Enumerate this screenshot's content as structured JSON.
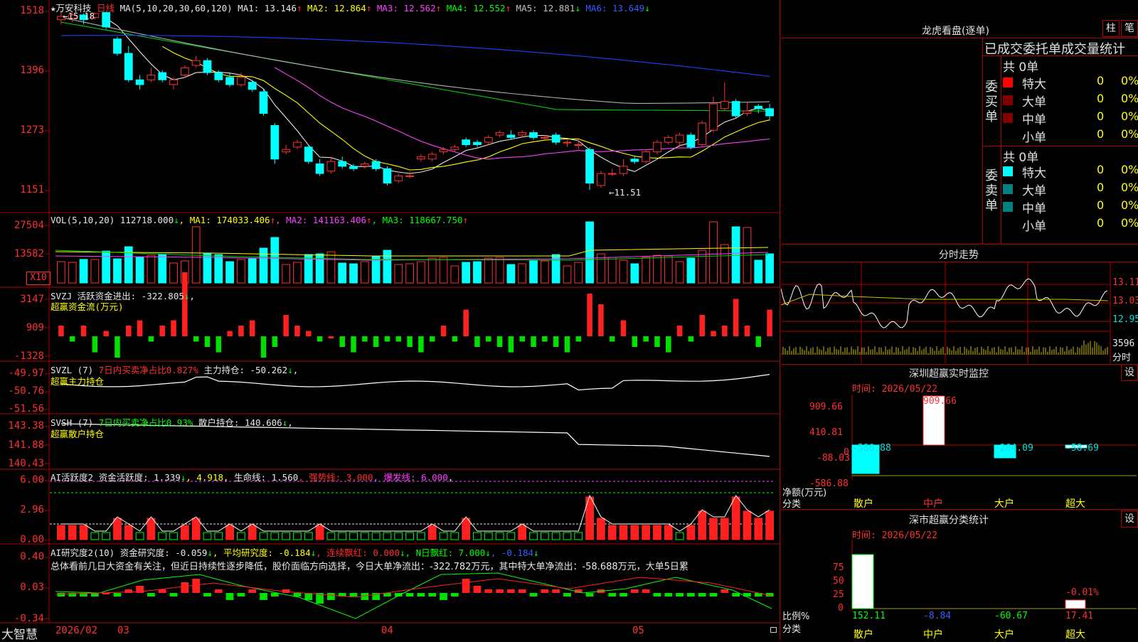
{
  "stock": {
    "name": "★万安科技",
    "period": "日线"
  },
  "price_panel": {
    "ma_info": [
      {
        "t": "MA(5,10,20,30,60,120)",
        "c": "c-w",
        "a": ""
      },
      {
        "t": " MA1: 13.146",
        "c": "c-w",
        "a": "↑"
      },
      {
        "t": " MA2: 12.864",
        "c": "c-y",
        "a": "↑"
      },
      {
        "t": " MA3: 12.562",
        "c": "c-m",
        "a": "↑"
      },
      {
        "t": " MA4: 12.552",
        "c": "c-g",
        "a": "↑"
      },
      {
        "t": " MA5: 12.881",
        "c": "c-gray",
        "a": "↓"
      },
      {
        "t": " MA6: 13.649",
        "c": "c-b",
        "a": "↓"
      }
    ],
    "axis": [
      "1518",
      "1396",
      "1273",
      "1151"
    ],
    "high_mark": "←15.18",
    "low_mark": "←11.51"
  },
  "vol_panel": {
    "info": [
      {
        "t": "VOL(5,10,20) ",
        "c": "c-w",
        "a": ""
      },
      {
        "t": "112718.000",
        "c": "c-w",
        "a": "↓"
      },
      {
        "t": ", MA1: 174033.406",
        "c": "c-y",
        "a": "↑"
      },
      {
        "t": ", MA2: 141163.406",
        "c": "c-m",
        "a": "↑"
      },
      {
        "t": ", MA3: 118667.750",
        "c": "c-g",
        "a": "↑"
      }
    ],
    "axis": [
      "27504",
      "13582"
    ],
    "unit": "X10"
  },
  "svzj_panel": {
    "line1": [
      {
        "t": "SVZJ  活跃资金进出: -322.805",
        "c": "c-w",
        "a": "↓"
      },
      {
        "t": ",",
        "c": "c-w",
        "a": ""
      }
    ],
    "line2": "超赢资金流(万元)",
    "axis": [
      "3147",
      "909",
      "-1328"
    ]
  },
  "svzl_panel": {
    "line1": [
      {
        "t": "SVZL (7) ",
        "c": "c-w",
        "a": ""
      },
      {
        "t": "7日内买卖净占比0.827%",
        "c": "c-r",
        "a": ""
      },
      {
        "t": " 主力持仓: -50.262",
        "c": "c-w",
        "a": "↓"
      },
      {
        "t": ",",
        "c": "c-w",
        "a": ""
      }
    ],
    "line2": "超赢主力持仓",
    "axis": [
      "-49.97",
      "-50.76",
      "-51.56"
    ]
  },
  "svsh_panel": {
    "line1": [
      {
        "t": "SVSH (7) ",
        "c": "c-w",
        "a": ""
      },
      {
        "t": "7日内买卖净占比0.93%",
        "c": "c-g",
        "a": ""
      },
      {
        "t": " 散户持仓: 140.606",
        "c": "c-w",
        "a": "↓"
      },
      {
        "t": ",",
        "c": "c-w",
        "a": ""
      }
    ],
    "line2": "超赢散户持仓",
    "axis": [
      "143.38",
      "141.88",
      "140.43"
    ]
  },
  "ai1_panel": {
    "line1": [
      {
        "t": "AI活跃度2 资金活跃度: 1.339",
        "c": "c-w",
        "a": "↓"
      },
      {
        "t": ", 4.918",
        "c": "c-y",
        "a": ""
      },
      {
        "t": ", 生命线: 1.560",
        "c": "c-w",
        "a": ""
      },
      {
        "t": ", 强势线: 3.000",
        "c": "c-r",
        "a": ""
      },
      {
        "t": ", 爆发线: 6.000",
        "c": "c-m",
        "a": ""
      },
      {
        "t": ",",
        "c": "c-w",
        "a": ""
      }
    ],
    "axis": [
      "6.00",
      "2.96",
      "0.00"
    ]
  },
  "ai2_panel": {
    "line1": [
      {
        "t": "AI研究度2(10) 资金研究度: -0.059",
        "c": "c-w",
        "a": "↓"
      },
      {
        "t": ", 平均研究度: -0.184",
        "c": "c-y",
        "a": "↓"
      },
      {
        "t": ", 连续飘红: 0.000",
        "c": "c-r",
        "a": "↓"
      },
      {
        "t": ", N日飘红: 7.000",
        "c": "c-g",
        "a": "↓"
      },
      {
        "t": ", -0.184",
        "c": "c-b",
        "a": "↓"
      }
    ],
    "summary": "总体看前几日大资金有关注，但近日持续性逐步降低，股价面临方向选择，今日大单净流出：-322.782万元，其中特大单净流出：-58.688万元，大单5日累",
    "axis": [
      "0.40",
      "0.03",
      "-0.34"
    ]
  },
  "dates": {
    "d1": "2026/02",
    "d2": "03",
    "d3": "04",
    "d4": "05"
  },
  "brand": "大智慧",
  "right": {
    "dragon_title": "龙虎看盘(逐单)",
    "btn_bar": "柱",
    "btn_pen": "笔",
    "dragon_header": "已成交委托单成交量统计",
    "buy_label": "委买单",
    "sell_label": "委卖单",
    "buy_total": "共 0单",
    "sell_total": "共 0单",
    "buy_rows": [
      {
        "label": "特大",
        "v": "0",
        "p": "0%",
        "color": "#ff0000"
      },
      {
        "label": "大单",
        "v": "0",
        "p": "0%",
        "color": "#800000"
      },
      {
        "label": "中单",
        "v": "0",
        "p": "0%",
        "color": "#800000"
      },
      {
        "label": "小单",
        "v": "0",
        "p": "0%",
        "color": ""
      }
    ],
    "sell_rows": [
      {
        "label": "特大",
        "v": "0",
        "p": "0%",
        "color": "#00ffff"
      },
      {
        "label": "大单",
        "v": "0",
        "p": "0%",
        "color": "#008080"
      },
      {
        "label": "中单",
        "v": "0",
        "p": "0%",
        "color": "#008080"
      },
      {
        "label": "小单",
        "v": "0",
        "p": "0%",
        "color": ""
      }
    ],
    "intraday_title": "分时走势",
    "intraday_axis": [
      "13.11",
      "13.03",
      "12.95"
    ],
    "intraday_vol": "3596",
    "intraday_unit": "分时",
    "monitor_title": "深圳超赢实时监控",
    "monitor_btn": "设",
    "monitor_time": "时间: 2026/05/22",
    "monitor_axis": [
      "909.66",
      "410.81",
      "-88.03",
      "-586.88"
    ],
    "monitor_axis_zero": "0",
    "monitor_unit1": "净额(万元)",
    "monitor_unit2": "分类",
    "monitor_cats": [
      "散户",
      "中户",
      "大户",
      "超大"
    ],
    "monitor_values": [
      "-586.88",
      "909.66",
      "-264.09",
      "-58.69"
    ],
    "class_title": "深市超赢分类统计",
    "class_btn": "设",
    "class_time": "时间: 2026/05/22",
    "class_axis": [
      "75",
      "50",
      "25",
      "0"
    ],
    "class_unit1": "比例%",
    "class_unit2": "分类",
    "class_cats": [
      "散户",
      "中户",
      "大户",
      "超大"
    ],
    "class_values": [
      "152.11",
      "-8.84",
      "-60.67",
      "17.41"
    ],
    "class_extra": "-0.01%"
  },
  "chart_data": [
    {
      "type": "candlestick",
      "y_axis_ticks": [
        "1518",
        "1396",
        "1273",
        "1151"
      ],
      "candles": [
        [
          15.05,
          15.12,
          14.95,
          15.25
        ],
        [
          15.08,
          15.15,
          15.0,
          15.2
        ],
        [
          15.15,
          15.05,
          14.95,
          15.18
        ],
        [
          15.1,
          15.18,
          15.05,
          15.2
        ],
        [
          15.2,
          14.9,
          14.85,
          15.22
        ],
        [
          14.65,
          14.35,
          14.3,
          14.7
        ],
        [
          14.35,
          13.8,
          13.75,
          14.5
        ],
        [
          13.8,
          13.7,
          13.6,
          13.9
        ],
        [
          13.8,
          13.9,
          13.75,
          14.05
        ],
        [
          13.95,
          13.8,
          13.75,
          14.0
        ],
        [
          13.7,
          13.8,
          13.6,
          13.85
        ],
        [
          13.9,
          14.05,
          13.85,
          14.1
        ],
        [
          14.1,
          14.2,
          14.05,
          14.3
        ],
        [
          14.2,
          13.95,
          13.9,
          14.25
        ],
        [
          13.95,
          13.8,
          13.75,
          14.0
        ],
        [
          13.85,
          13.7,
          13.65,
          13.95
        ],
        [
          13.7,
          13.85,
          13.65,
          13.95
        ],
        [
          13.75,
          13.6,
          13.55,
          13.8
        ],
        [
          13.55,
          13.1,
          13.05,
          13.6
        ],
        [
          12.85,
          12.15,
          12.05,
          12.9
        ],
        [
          12.3,
          12.35,
          12.25,
          12.45
        ],
        [
          12.4,
          12.5,
          12.35,
          12.55
        ],
        [
          12.4,
          12.1,
          12.05,
          12.45
        ],
        [
          12.05,
          11.85,
          11.8,
          12.15
        ],
        [
          11.9,
          12.1,
          11.85,
          12.2
        ],
        [
          12.1,
          12.0,
          11.95,
          12.2
        ],
        [
          12.0,
          11.95,
          11.9,
          12.05
        ],
        [
          12.0,
          12.05,
          11.95,
          12.1
        ],
        [
          12.1,
          11.95,
          11.9,
          12.15
        ],
        [
          11.95,
          11.65,
          11.6,
          12.0
        ],
        [
          11.7,
          11.8,
          11.65,
          11.85
        ],
        [
          11.8,
          11.8,
          11.75,
          11.9
        ],
        [
          12.15,
          12.2,
          12.1,
          12.25
        ],
        [
          12.15,
          12.25,
          12.1,
          12.3
        ],
        [
          12.3,
          12.35,
          12.25,
          12.4
        ],
        [
          12.35,
          12.4,
          12.3,
          12.45
        ],
        [
          12.55,
          12.45,
          12.4,
          12.6
        ],
        [
          12.5,
          12.45,
          12.4,
          12.55
        ],
        [
          12.5,
          12.6,
          12.45,
          12.65
        ],
        [
          12.65,
          12.7,
          12.6,
          12.75
        ],
        [
          12.65,
          12.6,
          12.55,
          12.75
        ],
        [
          12.65,
          12.7,
          12.6,
          12.75
        ],
        [
          12.7,
          12.6,
          12.55,
          12.75
        ],
        [
          12.6,
          12.6,
          12.55,
          12.65
        ],
        [
          12.65,
          12.5,
          12.45,
          12.7
        ],
        [
          12.5,
          12.5,
          12.4,
          12.55
        ],
        [
          12.45,
          12.45,
          12.35,
          12.55
        ],
        [
          12.35,
          11.65,
          11.51,
          12.4
        ],
        [
          11.6,
          11.85,
          11.55,
          11.9
        ],
        [
          11.85,
          11.85,
          11.8,
          11.95
        ],
        [
          11.85,
          12.0,
          11.8,
          12.15
        ],
        [
          12.15,
          12.1,
          12.05,
          12.2
        ],
        [
          12.1,
          12.3,
          12.05,
          12.35
        ],
        [
          12.3,
          12.5,
          12.25,
          12.55
        ],
        [
          12.5,
          12.6,
          12.45,
          12.65
        ],
        [
          12.5,
          12.65,
          12.4,
          12.7
        ],
        [
          12.65,
          12.4,
          12.35,
          12.7
        ],
        [
          12.45,
          12.9,
          12.4,
          12.95
        ],
        [
          12.75,
          13.3,
          12.7,
          13.45
        ],
        [
          13.2,
          13.35,
          13.15,
          13.75
        ],
        [
          13.35,
          13.05,
          13.0,
          13.4
        ],
        [
          13.1,
          13.15,
          13.05,
          13.35
        ],
        [
          13.25,
          13.2,
          13.1,
          13.3
        ],
        [
          13.2,
          13.05,
          12.95,
          13.3
        ]
      ]
    }
  ]
}
